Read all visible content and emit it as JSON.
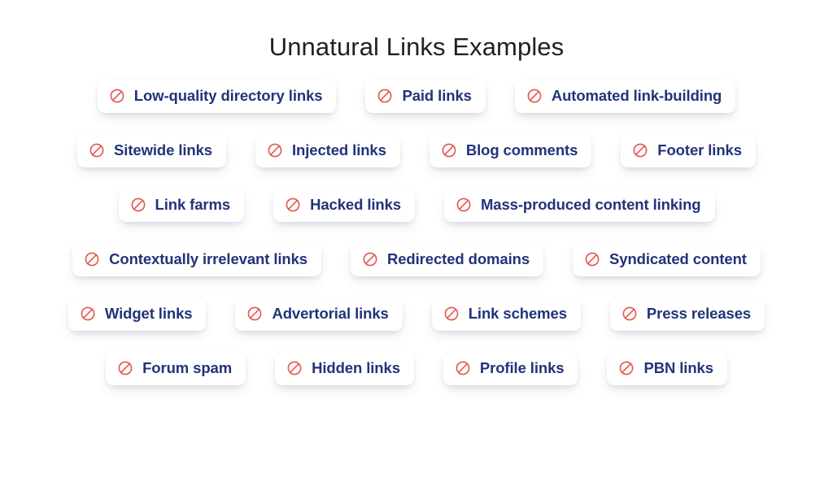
{
  "page": {
    "title": "Unnatural Links Examples",
    "background_color": "#ffffff",
    "title_color": "#212121"
  },
  "theme": {
    "tag_background": "#ffffff",
    "label_color": "#22337a",
    "icon_color": "#e2564d",
    "icon_name": "prohibition-icon"
  },
  "rows": [
    {
      "tags": [
        {
          "label": "Low-quality directory links",
          "icon": "prohibition-icon"
        },
        {
          "label": "Paid links",
          "icon": "prohibition-icon"
        },
        {
          "label": "Automated link-building",
          "icon": "prohibition-icon"
        }
      ]
    },
    {
      "tags": [
        {
          "label": "Sitewide links",
          "icon": "prohibition-icon"
        },
        {
          "label": "Injected links",
          "icon": "prohibition-icon"
        },
        {
          "label": "Blog comments",
          "icon": "prohibition-icon"
        },
        {
          "label": "Footer links",
          "icon": "prohibition-icon"
        }
      ]
    },
    {
      "tags": [
        {
          "label": "Link farms",
          "icon": "prohibition-icon"
        },
        {
          "label": "Hacked links",
          "icon": "prohibition-icon"
        },
        {
          "label": "Mass-produced content linking",
          "icon": "prohibition-icon"
        }
      ]
    },
    {
      "tags": [
        {
          "label": "Contextually irrelevant links",
          "icon": "prohibition-icon"
        },
        {
          "label": "Redirected domains",
          "icon": "prohibition-icon"
        },
        {
          "label": "Syndicated content",
          "icon": "prohibition-icon"
        }
      ]
    },
    {
      "tags": [
        {
          "label": "Widget links",
          "icon": "prohibition-icon"
        },
        {
          "label": "Advertorial links",
          "icon": "prohibition-icon"
        },
        {
          "label": "Link schemes",
          "icon": "prohibition-icon"
        },
        {
          "label": "Press releases",
          "icon": "prohibition-icon"
        }
      ]
    },
    {
      "tags": [
        {
          "label": "Forum spam",
          "icon": "prohibition-icon"
        },
        {
          "label": "Hidden links",
          "icon": "prohibition-icon"
        },
        {
          "label": "Profile links",
          "icon": "prohibition-icon"
        },
        {
          "label": "PBN links",
          "icon": "prohibition-icon"
        }
      ]
    }
  ]
}
